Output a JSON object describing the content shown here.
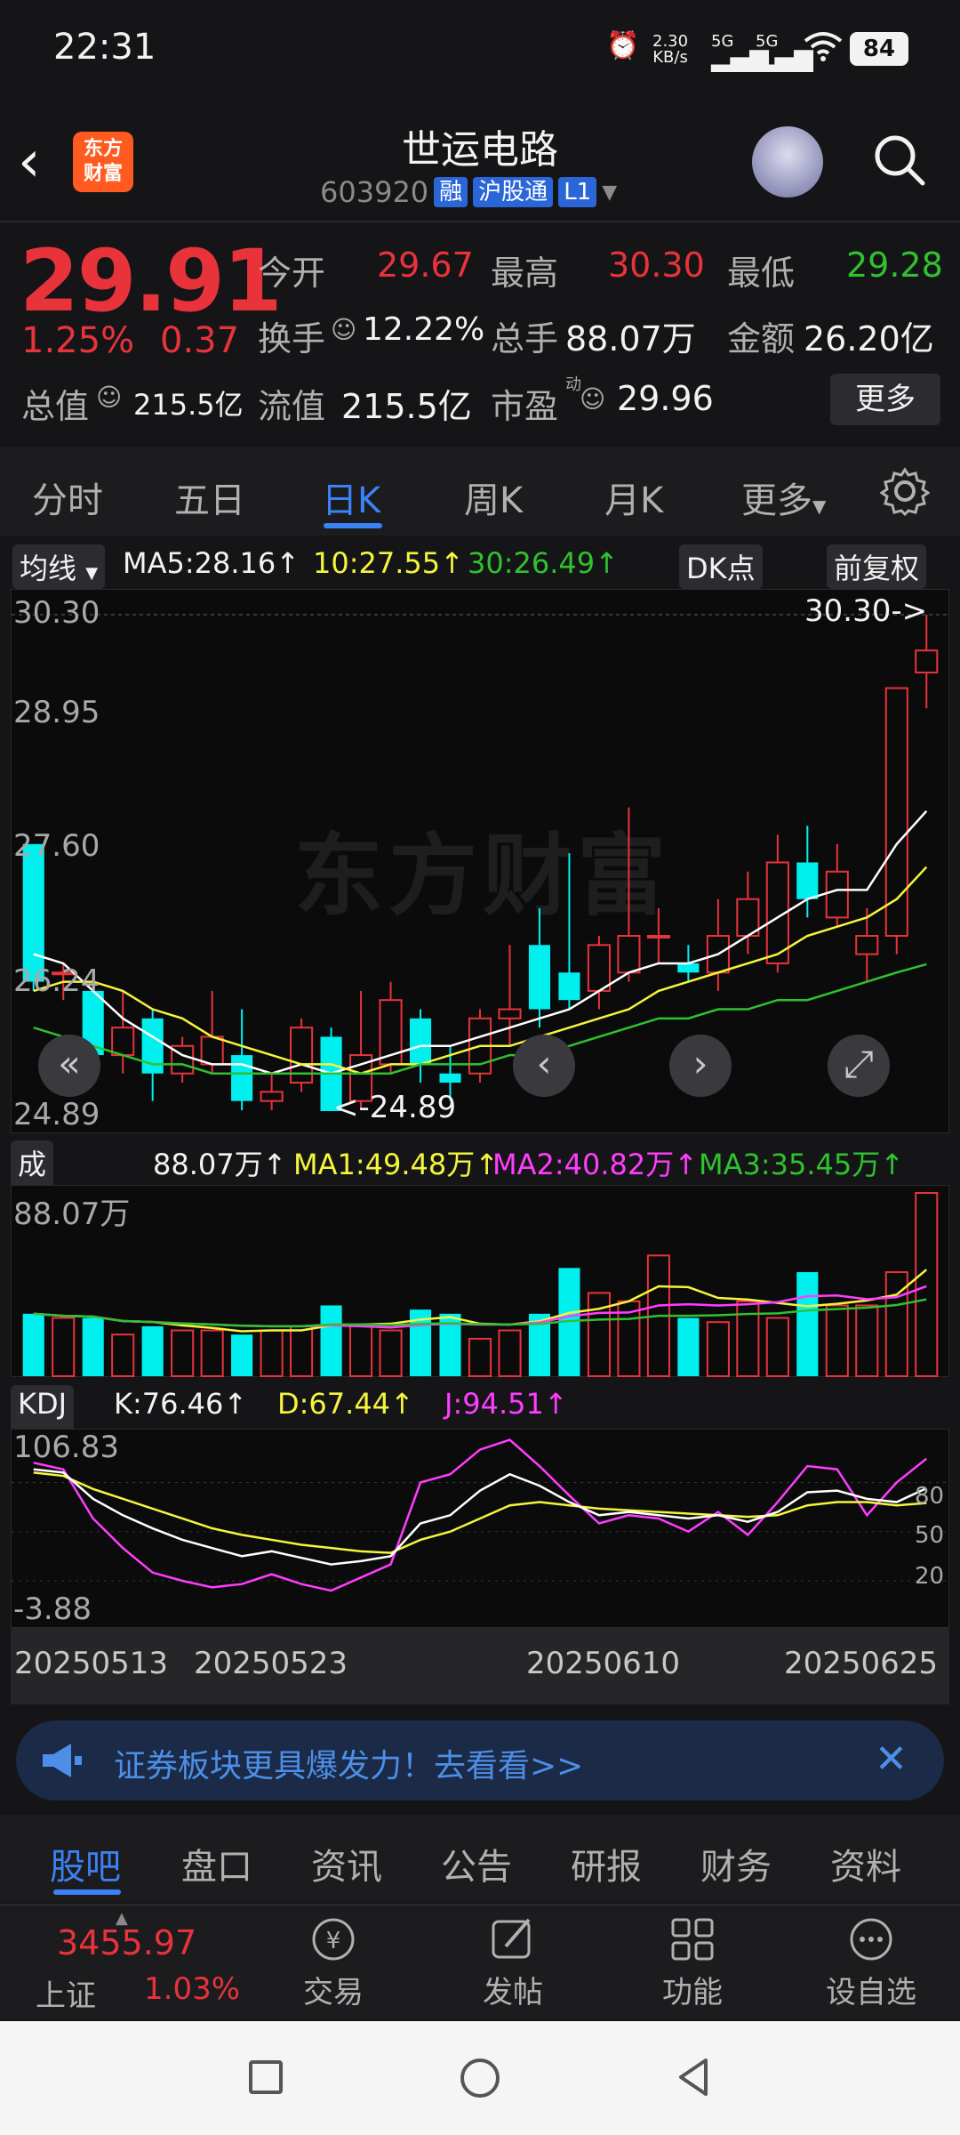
{
  "status_bar": {
    "time": "22:31",
    "net_speed_top": "2.30",
    "net_speed_bottom": "KB/s",
    "signal1": "5G",
    "signal2": "5G",
    "battery": "84"
  },
  "header": {
    "stock_name": "世运电路",
    "stock_code": "603920",
    "tags": [
      "融",
      "沪股通",
      "L1"
    ],
    "logo_text": "东方财富"
  },
  "quote": {
    "price": "29.91",
    "change_pct": "1.25%",
    "change": "0.37",
    "open_label": "今开",
    "open": "29.67",
    "high_label": "最高",
    "high": "30.30",
    "low_label": "最低",
    "low": "29.28",
    "turnover_label": "换手",
    "turnover": "12.22%",
    "volume_label": "总手",
    "volume": "88.07万",
    "amount_label": "金额",
    "amount": "26.20亿",
    "mktcap_label": "总值",
    "mktcap": "215.5亿",
    "float_label": "流值",
    "float_cap": "215.5亿",
    "pe_label": "市盈",
    "pe_sup": "动",
    "pe": "29.96",
    "more_label": "更多"
  },
  "period_tabs": [
    "分时",
    "五日",
    "日K",
    "周K",
    "月K",
    "更多"
  ],
  "ma_row": {
    "selector": "均线",
    "ma5": "MA5:28.16",
    "ma10": "10:27.55",
    "ma30": "30:26.49",
    "dk_label": "DK点",
    "adjust_label": "前复权"
  },
  "price_axis": [
    "30.30",
    "28.95",
    "27.60",
    "26.24",
    "24.89"
  ],
  "chart_annotations": {
    "high_marker": "30.30->",
    "low_marker": "<-24.89",
    "watermark": "东方财富"
  },
  "volume_row": {
    "selector": "成交量",
    "vol": "88.07万",
    "ma1": "MA1:49.48万",
    "ma2": "MA2:40.82万",
    "ma3": "MA3:35.45万",
    "axis_top": "88.07万"
  },
  "kdj_row": {
    "selector": "KDJ",
    "k": "K:76.46",
    "d": "D:67.44",
    "j": "J:94.51",
    "axis_top": "106.83",
    "axis_bottom": "-3.88",
    "level_80": "80",
    "level_50": "50",
    "level_20": "20"
  },
  "dates": [
    "20250513",
    "20250523",
    "20250610",
    "20250625"
  ],
  "ad_banner": {
    "text": "证券板块更具爆发力！去看看>>",
    "close": "✕"
  },
  "info_tabs": [
    "股吧",
    "盘口",
    "资讯",
    "公告",
    "研报",
    "财务",
    "资料"
  ],
  "bottom_nav": {
    "index_value": "3455.97",
    "index_name": "上证",
    "index_pct": "1.03%",
    "items": [
      "交易",
      "发帖",
      "功能",
      "设自选"
    ]
  },
  "colors": {
    "up": "#e8333b",
    "down": "#00f0f0",
    "accent": "#3b82f6",
    "ma5": "#ffffff",
    "ma10": "#f5f53d",
    "ma30": "#2fc22f"
  },
  "chart_data": {
    "type": "candlestick",
    "price_range": [
      24.89,
      30.3
    ],
    "candles": [
      {
        "o": 27.8,
        "c": 26.3,
        "h": 27.8,
        "l": 26.2
      },
      {
        "o": 26.4,
        "c": 26.4,
        "h": 26.5,
        "l": 26.1
      },
      {
        "o": 26.2,
        "c": 25.5,
        "h": 26.3,
        "l": 25.4
      },
      {
        "o": 25.5,
        "c": 25.8,
        "h": 26.2,
        "l": 25.3
      },
      {
        "o": 25.9,
        "c": 25.3,
        "h": 26.0,
        "l": 25.0
      },
      {
        "o": 25.3,
        "c": 25.6,
        "h": 25.7,
        "l": 25.2
      },
      {
        "o": 25.4,
        "c": 25.7,
        "h": 26.2,
        "l": 25.3
      },
      {
        "o": 25.5,
        "c": 25.0,
        "h": 26.0,
        "l": 24.9
      },
      {
        "o": 25.0,
        "c": 25.1,
        "h": 25.3,
        "l": 24.9
      },
      {
        "o": 25.2,
        "c": 25.8,
        "h": 25.9,
        "l": 25.1
      },
      {
        "o": 25.7,
        "c": 24.89,
        "h": 25.8,
        "l": 24.89
      },
      {
        "o": 25.0,
        "c": 25.5,
        "h": 26.2,
        "l": 24.9
      },
      {
        "o": 25.4,
        "c": 26.1,
        "h": 26.3,
        "l": 25.3
      },
      {
        "o": 25.9,
        "c": 25.4,
        "h": 26.0,
        "l": 25.2
      },
      {
        "o": 25.3,
        "c": 25.2,
        "h": 25.6,
        "l": 25.0
      },
      {
        "o": 25.3,
        "c": 25.9,
        "h": 26.0,
        "l": 25.2
      },
      {
        "o": 25.9,
        "c": 26.0,
        "h": 26.7,
        "l": 25.6
      },
      {
        "o": 26.7,
        "c": 26.0,
        "h": 27.1,
        "l": 25.8
      },
      {
        "o": 26.4,
        "c": 26.1,
        "h": 27.7,
        "l": 26.0
      },
      {
        "o": 26.2,
        "c": 26.7,
        "h": 26.8,
        "l": 26.0
      },
      {
        "o": 26.4,
        "c": 26.8,
        "h": 28.2,
        "l": 26.3
      },
      {
        "o": 26.8,
        "c": 26.8,
        "h": 27.1,
        "l": 26.5
      },
      {
        "o": 26.5,
        "c": 26.4,
        "h": 26.7,
        "l": 26.3
      },
      {
        "o": 26.4,
        "c": 26.8,
        "h": 27.2,
        "l": 26.2
      },
      {
        "o": 26.8,
        "c": 27.2,
        "h": 27.5,
        "l": 26.6
      },
      {
        "o": 26.5,
        "c": 27.6,
        "h": 27.9,
        "l": 26.4
      },
      {
        "o": 27.6,
        "c": 27.2,
        "h": 28.0,
        "l": 27.0
      },
      {
        "o": 27.0,
        "c": 27.5,
        "h": 27.8,
        "l": 26.9
      },
      {
        "o": 26.6,
        "c": 26.8,
        "h": 27.1,
        "l": 26.3
      },
      {
        "o": 26.8,
        "c": 29.5,
        "h": 29.5,
        "l": 26.6
      },
      {
        "o": 29.67,
        "c": 29.91,
        "h": 30.3,
        "l": 29.28
      }
    ],
    "ma5": [
      26.6,
      26.5,
      26.2,
      25.9,
      25.7,
      25.5,
      25.4,
      25.4,
      25.3,
      25.4,
      25.3,
      25.4,
      25.5,
      25.6,
      25.6,
      25.7,
      25.8,
      25.9,
      26.0,
      26.2,
      26.4,
      26.5,
      26.5,
      26.6,
      26.8,
      27.0,
      27.2,
      27.3,
      27.3,
      27.8,
      28.16
    ],
    "ma10": [
      26.2,
      26.3,
      26.3,
      26.2,
      26.0,
      25.9,
      25.7,
      25.6,
      25.5,
      25.4,
      25.4,
      25.3,
      25.4,
      25.4,
      25.5,
      25.6,
      25.6,
      25.7,
      25.8,
      25.9,
      26.0,
      26.2,
      26.3,
      26.4,
      26.5,
      26.6,
      26.8,
      26.9,
      27.0,
      27.2,
      27.55
    ],
    "ma30": [
      25.8,
      25.7,
      25.6,
      25.5,
      25.4,
      25.4,
      25.3,
      25.3,
      25.3,
      25.3,
      25.3,
      25.3,
      25.3,
      25.4,
      25.4,
      25.4,
      25.5,
      25.5,
      25.6,
      25.7,
      25.8,
      25.9,
      25.9,
      26.0,
      26.0,
      26.1,
      26.1,
      26.2,
      26.3,
      26.4,
      26.49
    ],
    "volume": [
      30,
      28,
      28,
      20,
      24,
      22,
      22,
      20,
      22,
      24,
      34,
      24,
      22,
      32,
      30,
      18,
      22,
      30,
      52,
      40,
      36,
      58,
      28,
      26,
      36,
      28,
      50,
      34,
      34,
      50,
      88.07
    ],
    "vol_range": [
      0,
      88.07
    ],
    "kdj_range": [
      -3.88,
      106.83
    ],
    "k": [
      88,
      86,
      70,
      60,
      52,
      45,
      40,
      35,
      38,
      34,
      30,
      32,
      35,
      55,
      60,
      75,
      85,
      78,
      68,
      60,
      62,
      60,
      58,
      60,
      56,
      62,
      74,
      75,
      70,
      68,
      76.46
    ],
    "d": [
      86,
      84,
      76,
      70,
      64,
      58,
      52,
      48,
      45,
      42,
      40,
      38,
      37,
      45,
      50,
      58,
      66,
      68,
      66,
      64,
      63,
      62,
      61,
      60,
      59,
      60,
      66,
      68,
      68,
      66,
      67.44
    ],
    "j": [
      92,
      88,
      58,
      40,
      25,
      20,
      16,
      18,
      24,
      18,
      14,
      22,
      30,
      80,
      85,
      100,
      106,
      90,
      72,
      55,
      60,
      58,
      50,
      62,
      48,
      68,
      90,
      88,
      60,
      80,
      94.51
    ]
  }
}
